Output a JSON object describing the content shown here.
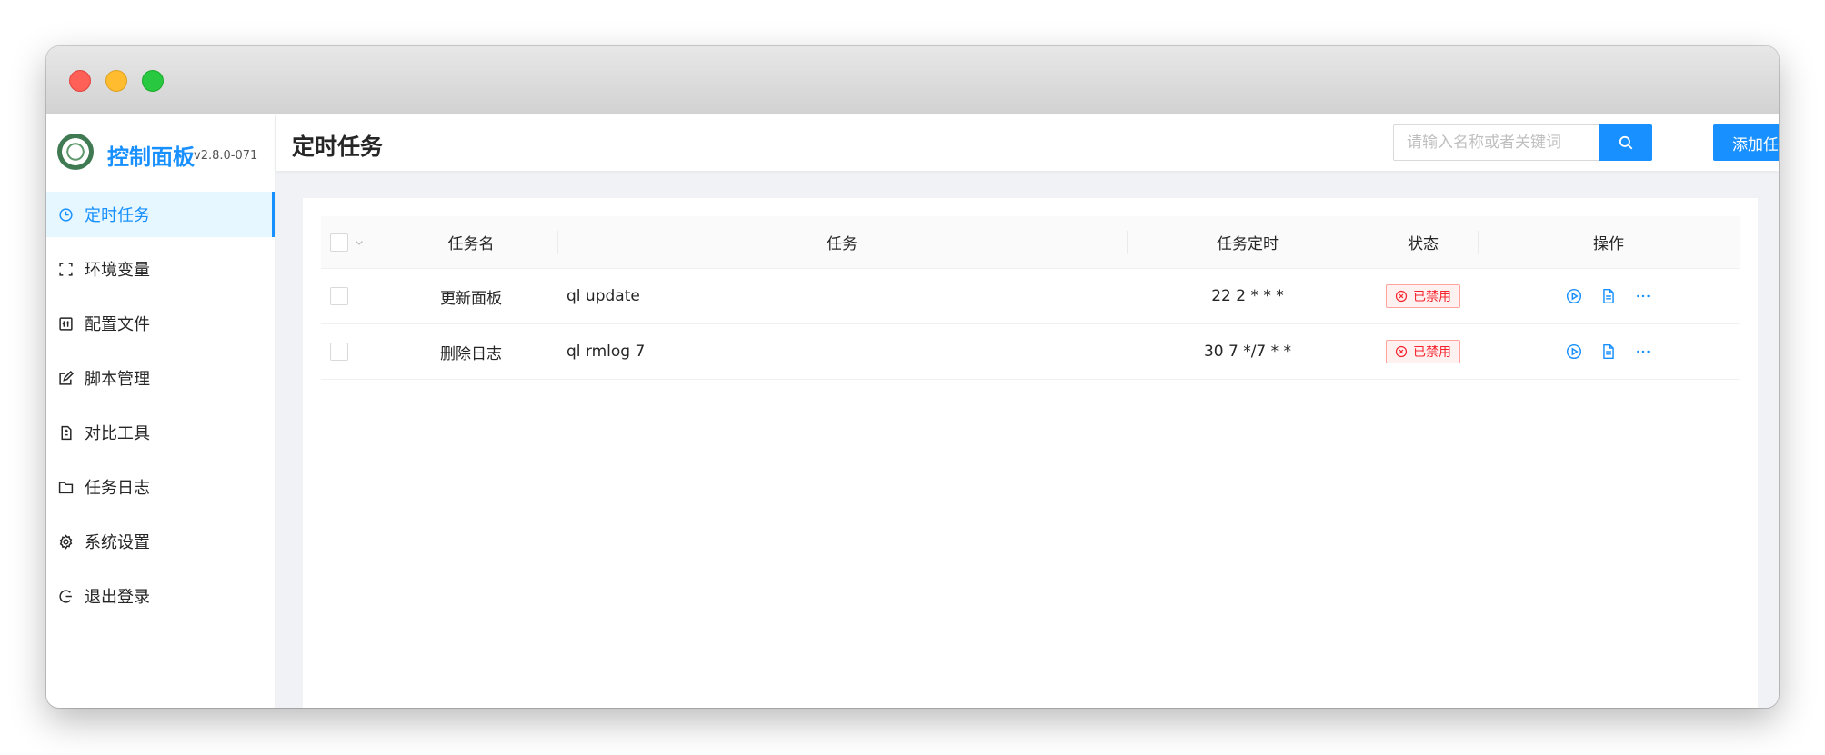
{
  "brand": {
    "title": "控制面板",
    "version": "v2.8.0-071"
  },
  "sidebar": {
    "items": [
      {
        "label": "定时任务",
        "icon": "clock-icon",
        "active": true
      },
      {
        "label": "环境变量",
        "icon": "variable-icon",
        "active": false
      },
      {
        "label": "配置文件",
        "icon": "settings-file-icon",
        "active": false
      },
      {
        "label": "脚本管理",
        "icon": "edit-icon",
        "active": false
      },
      {
        "label": "对比工具",
        "icon": "diff-icon",
        "active": false
      },
      {
        "label": "任务日志",
        "icon": "folder-icon",
        "active": false
      },
      {
        "label": "系统设置",
        "icon": "gear-icon",
        "active": false
      },
      {
        "label": "退出登录",
        "icon": "logout-icon",
        "active": false
      }
    ]
  },
  "header": {
    "title": "定时任务",
    "search_placeholder": "请输入名称或者关键词",
    "add_button": "添加任务"
  },
  "table": {
    "columns": [
      "任务名",
      "任务",
      "任务定时",
      "状态",
      "操作"
    ],
    "rows": [
      {
        "name": "更新面板",
        "command": "ql update",
        "schedule": "22 2 * * *",
        "status": "已禁用"
      },
      {
        "name": "删除日志",
        "command": "ql rmlog 7",
        "schedule": "30 7 */7 * *",
        "status": "已禁用"
      }
    ]
  },
  "colors": {
    "accent": "#1890ff",
    "disabled_tag": "#f5222d"
  }
}
